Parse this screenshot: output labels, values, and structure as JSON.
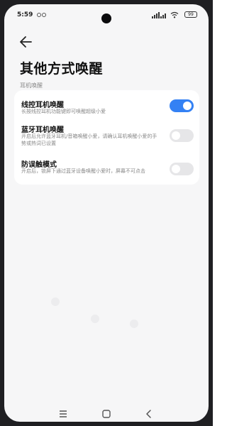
{
  "status_bar": {
    "time": "5:59",
    "battery": "99"
  },
  "header": {
    "title": "其他方式唤醒"
  },
  "section": {
    "header": "耳机唤醒"
  },
  "settings": [
    {
      "title": "线控耳机唤醒",
      "desc": "长按线控耳机功能键即可唤醒超级小爱",
      "enabled": true
    },
    {
      "title": "蓝牙耳机唤醒",
      "desc": "开启后允许蓝牙耳机/音箱唤醒小爱，请确认耳机唤醒小爱的手势或热词已设置",
      "enabled": false
    },
    {
      "title": "防误触模式",
      "desc": "开启后，锁屏下通过蓝牙设备唤醒小爱时，屏幕不可点击",
      "enabled": false
    }
  ],
  "colors": {
    "accent": "#3481f4",
    "toggle_off": "#e6e6e8"
  },
  "icons": {
    "back": "arrow-left-icon",
    "nav_menu": "menu-icon",
    "nav_home": "home-square-icon",
    "nav_back": "back-chevron-icon"
  }
}
